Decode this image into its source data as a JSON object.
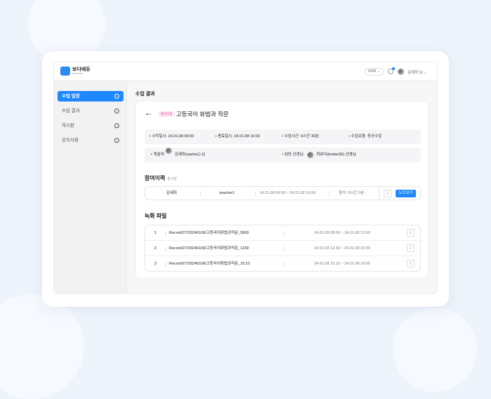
{
  "header": {
    "logo_title": "보다에듀",
    "logo_sub": "BODA EDU",
    "lang": "KOR ⌄",
    "user": "김새하 님 ⌄"
  },
  "sidebar": {
    "items": [
      {
        "label": "수업 입장"
      },
      {
        "label": "수업 결과"
      },
      {
        "label": "게시판"
      },
      {
        "label": "공지사항"
      }
    ]
  },
  "page_title": "수업 결과",
  "class": {
    "badge": "정규수업",
    "title": "고등국어 화법과 작문",
    "start": "• 시작일시: 24.01.08 09:00",
    "end": "• 종료일시: 24.01.08 16:00",
    "duration": "• 수업시간: 6시간 30분",
    "type": "• 수업유형: 정규수업",
    "opener_label": "• 개설자:",
    "opener": "김새하(saeha1) 님",
    "teacher_label": "• 담당 선생님:",
    "teacher": "최보다(bodac56) 선생님"
  },
  "participation": {
    "title": "참여이력",
    "count": "총 5명",
    "row": {
      "name": "김새하",
      "id": "teacher1",
      "period": "24.01.08 09:00 ~ 24.01.08 16:00",
      "attend": "참석: 9시간 0분",
      "note_button": "노트보기"
    }
  },
  "recordings": {
    "title": "녹화 파일",
    "rows": [
      {
        "no": "1",
        "file": "Record/27/20240108/고등국어화법과작문_0900",
        "period": "24.01.08 09:00 ~ 24.01.08 12:00"
      },
      {
        "no": "2",
        "file": "Record/27/20240108/고등국어화법과작문_1230",
        "period": "24.01.08 12:30 ~ 24.01.08 15:00"
      },
      {
        "no": "3",
        "file": "Record/27/20240108/고등국어화법과작문_15:10",
        "period": "24.01.08 15:10 ~ 24.01.08 16:00"
      }
    ]
  }
}
